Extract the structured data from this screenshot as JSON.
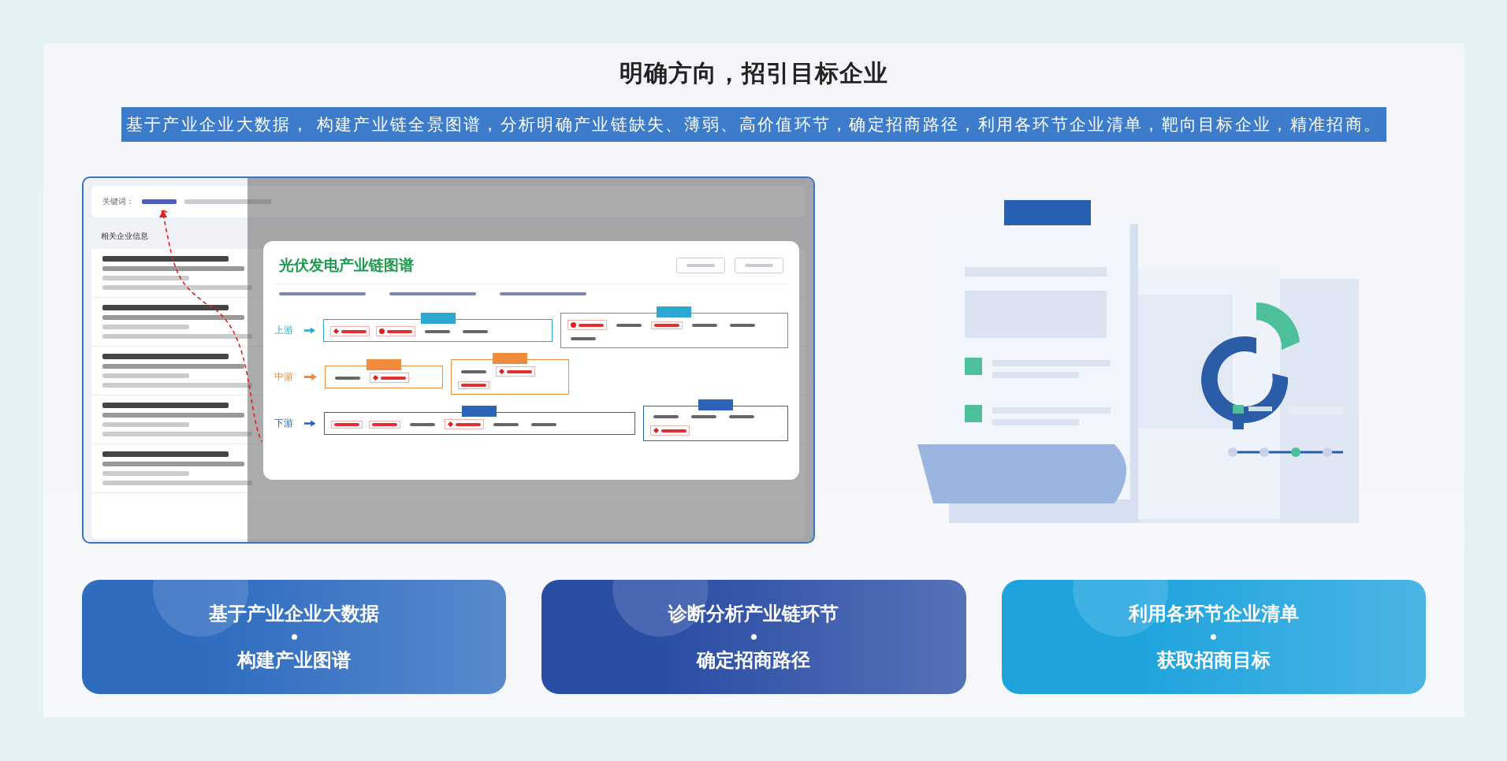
{
  "heading": "明确方向，招引目标企业",
  "subheading": "基于产业企业大数据， 构建产业链全景图谱，分析明确产业链缺失、薄弱、高价值环节，确定招商路径，利用各环节企业清单，靶向目标企业，精准招商。",
  "screenshot": {
    "keyword_label": "关键词：",
    "list_title": "相关企业信息",
    "chart_title": "光伏发电产业链图谱",
    "tiers": [
      {
        "label": "上游",
        "color": "#2aa8d2",
        "groups": [
          {
            "items": [
              {
                "kind": "diamond"
              },
              {
                "kind": "dot"
              },
              {
                "kind": "plain"
              },
              {
                "kind": "plain"
              }
            ]
          },
          {
            "items": [
              {
                "kind": "dot"
              },
              {
                "kind": "plain"
              },
              {
                "kind": "boxed"
              },
              {
                "kind": "plain"
              },
              {
                "kind": "plain"
              },
              {
                "kind": "plain"
              }
            ]
          }
        ]
      },
      {
        "label": "中游",
        "color": "#f08a3c",
        "groups": [
          {
            "items": [
              {
                "kind": "plain"
              },
              {
                "kind": "diamond"
              }
            ]
          },
          {
            "items": [
              {
                "kind": "plain"
              },
              {
                "kind": "diamond"
              },
              {
                "kind": "boxed"
              }
            ]
          }
        ]
      },
      {
        "label": "下游",
        "color": "#2c63b6",
        "groups": [
          {
            "items": [
              {
                "kind": "boxed"
              },
              {
                "kind": "boxed"
              },
              {
                "kind": "plain"
              },
              {
                "kind": "diamond"
              },
              {
                "kind": "plain"
              },
              {
                "kind": "plain"
              }
            ]
          },
          {
            "items": [
              {
                "kind": "plain"
              },
              {
                "kind": "plain"
              },
              {
                "kind": "plain"
              },
              {
                "kind": "diamond"
              }
            ]
          }
        ]
      }
    ]
  },
  "cards": [
    {
      "title": "基于产业企业大数据",
      "subtitle": "构建产业图谱",
      "color": "#2f6cc0"
    },
    {
      "title": "诊断分析产业链环节",
      "subtitle": "确定招商路径",
      "color": "#2b4ea5"
    },
    {
      "title": "利用各环节企业清单",
      "subtitle": "获取招商目标",
      "color": "#1ea3dd"
    }
  ]
}
